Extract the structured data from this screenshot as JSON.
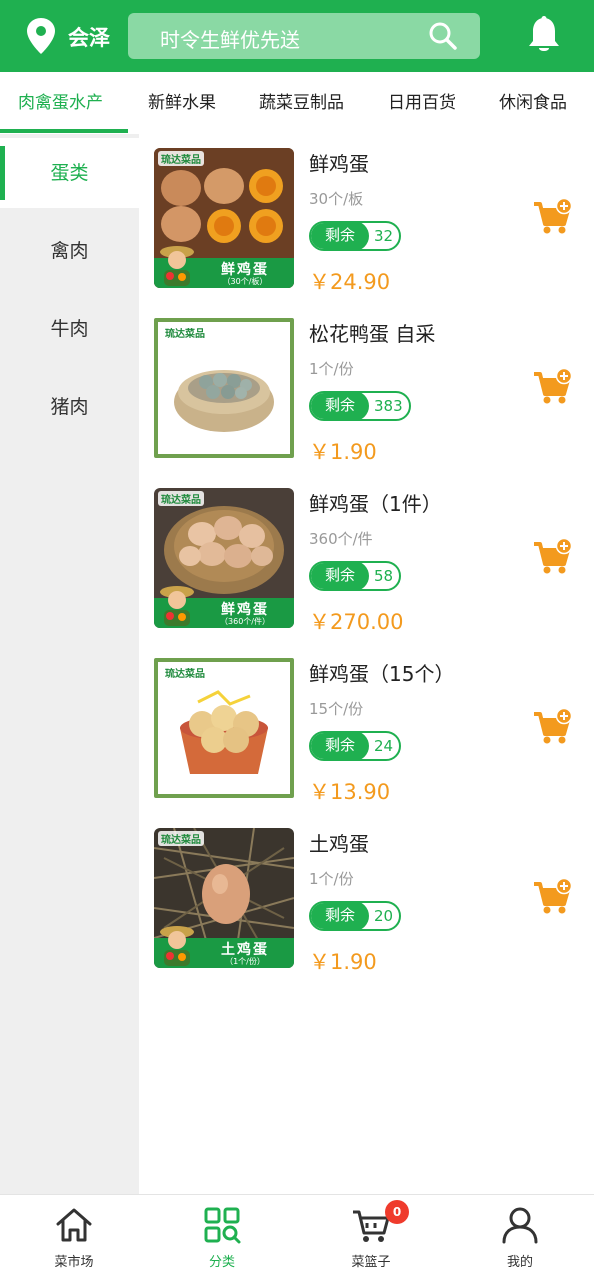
{
  "header": {
    "location": "会泽",
    "search_placeholder": "时令生鲜优先送",
    "accent_color": "#1fb050"
  },
  "tabs": [
    {
      "label": "肉禽蛋水产",
      "active": true
    },
    {
      "label": "新鲜水果",
      "active": false
    },
    {
      "label": "蔬菜豆制品",
      "active": false
    },
    {
      "label": "日用百货",
      "active": false
    },
    {
      "label": "休闲食品",
      "active": false
    }
  ],
  "sidebar": [
    {
      "label": "蛋类",
      "active": true
    },
    {
      "label": "禽肉",
      "active": false
    },
    {
      "label": "牛肉",
      "active": false
    },
    {
      "label": "猪肉",
      "active": false
    }
  ],
  "products": [
    {
      "name": "鲜鸡蛋",
      "spec": "30个/板",
      "stock_label": "剩余",
      "stock": "32",
      "price": "￥24.90",
      "image_title": "鲜鸡蛋",
      "image_sub": "（30个/板）",
      "brand": "琉达菜品"
    },
    {
      "name": "松花鸭蛋 自采",
      "spec": "1个/份",
      "stock_label": "剩余",
      "stock": "383",
      "price": "￥1.90",
      "brand": "琉达菜品"
    },
    {
      "name": "鲜鸡蛋（1件）",
      "spec": "360个/件",
      "stock_label": "剩余",
      "stock": "58",
      "price": "￥270.00",
      "image_title": "鲜鸡蛋",
      "image_sub": "（360个/件）",
      "brand": "琉达菜品"
    },
    {
      "name": "鲜鸡蛋（15个）",
      "spec": "15个/份",
      "stock_label": "剩余",
      "stock": "24",
      "price": "￥13.90",
      "brand": "琉达菜品"
    },
    {
      "name": "土鸡蛋",
      "spec": "1个/份",
      "stock_label": "剩余",
      "stock": "20",
      "price": "￥1.90",
      "image_title": "土鸡蛋",
      "image_sub": "（1个/份）",
      "brand": "琉达菜品"
    }
  ],
  "bottom_nav": [
    {
      "label": "菜市场",
      "icon": "home-icon",
      "active": false
    },
    {
      "label": "分类",
      "icon": "category-icon",
      "active": true
    },
    {
      "label": "菜篮子",
      "icon": "basket-icon",
      "active": false,
      "badge": "0"
    },
    {
      "label": "我的",
      "icon": "user-icon",
      "active": false
    }
  ]
}
